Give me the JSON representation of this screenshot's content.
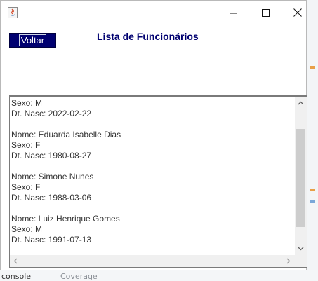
{
  "background": {
    "left_label": "console",
    "right_label": "Coverage"
  },
  "window": {
    "title_icon": "java-cup-icon",
    "controls": {
      "minimize": "minimize-icon",
      "maximize": "maximize-icon",
      "close": "close-icon"
    }
  },
  "toolbar": {
    "back_label": "Voltar"
  },
  "page": {
    "title": "Lista de Funcionários"
  },
  "employee_list": {
    "lines": [
      "Sexo: M",
      "Dt. Nasc: 2022-02-22",
      "",
      "Nome: Eduarda Isabelle Dias",
      "Sexo: F",
      "Dt. Nasc: 1980-08-27",
      "",
      "Nome: Simone Nunes",
      "Sexo: F",
      "Dt. Nasc: 1988-03-06",
      "",
      "Nome: Luiz Henrique Gomes",
      "Sexo: M",
      "Dt. Nasc: 1991-07-13"
    ],
    "vertical_scroll_fraction": 0.55
  },
  "colors": {
    "accent": "#000070",
    "title_text": "#000070",
    "body_text": "#333333"
  }
}
